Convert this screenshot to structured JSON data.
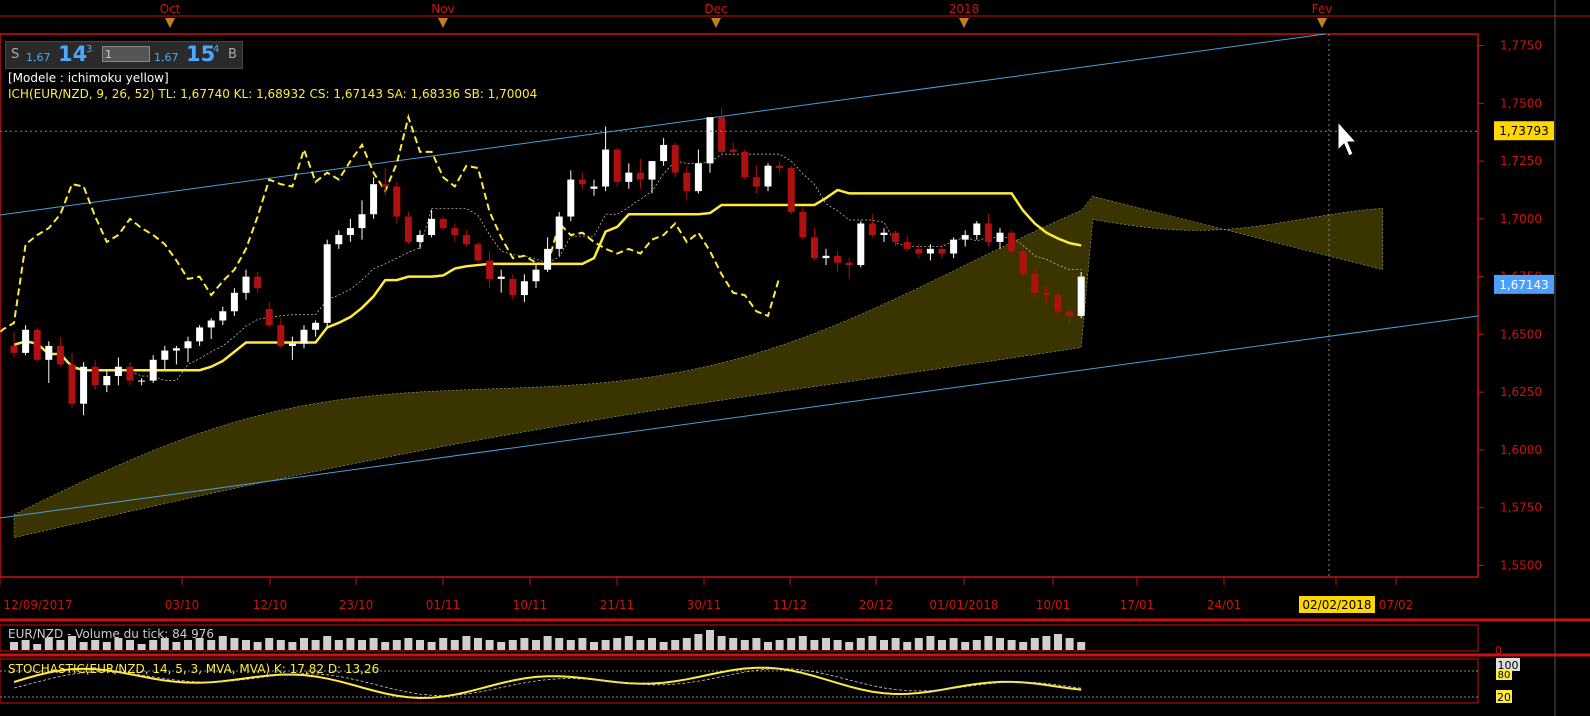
{
  "trade_panel": {
    "sell_label": "S",
    "bid_small": "1,67",
    "bid_big": "14",
    "bid_sup": "3",
    "quantity": "1",
    "ask_small": "1,67",
    "ask_big": "15",
    "ask_sup": "4",
    "buy_label": "B"
  },
  "info": {
    "model_line": "[Modele : ichimoku yellow]",
    "indicator_line": "ICH(EUR/NZD, 9, 26, 52)  TL: 1,67740  KL: 1,68932  CS: 1,67143  SA: 1,68336  SB: 1,70004"
  },
  "volume_panel": {
    "label": "EUR/NZD - Volume du tick: 84 976",
    "axis_zero": "0"
  },
  "stoch_panel": {
    "label": "STOCHASTIC(EUR/NZD, 14, 5, 3, MVA, MVA)  K: 17,82  D: 13,26",
    "level_100": "100",
    "level_80": "80",
    "level_20": "20"
  },
  "colors": {
    "axis": "#cc1111",
    "cloud": "#3a3500",
    "yellow": "#ffeb3b",
    "channel": "#4a9fd8",
    "up": "#ffffff",
    "down": "#b01010",
    "price_tag": "#4a9fff",
    "crosshair_tag": "#ffd700"
  },
  "chart_data": {
    "type": "candlestick",
    "symbol": "EUR/NZD",
    "top_axis_months": [
      "Oct",
      "Nov",
      "Dec",
      "2018",
      "Fev"
    ],
    "x_tick_labels": [
      "12/09/2017",
      "03/10",
      "12/10",
      "23/10",
      "01/11",
      "10/11",
      "21/11",
      "30/11",
      "11/12",
      "20/12",
      "01/01/2018",
      "10/01",
      "17/01",
      "24/01",
      "02/02/2018",
      "07/02"
    ],
    "y_tick_labels": [
      "1,7750",
      "1,7500",
      "1,7250",
      "1,7000",
      "1,6750",
      "1,6500",
      "1,6250",
      "1,6000",
      "1,5750",
      "1,5500"
    ],
    "ylim": [
      1.545,
      1.78
    ],
    "current_price_tag": "1,67143",
    "crosshair_price_tag": "1,73793",
    "crosshair_date_tag": "02/02/2018",
    "candles": [
      [
        1.645,
        1.651,
        1.64,
        1.642
      ],
      [
        1.642,
        1.654,
        1.641,
        1.652
      ],
      [
        1.652,
        1.653,
        1.638,
        1.639
      ],
      [
        1.639,
        1.647,
        1.629,
        1.645
      ],
      [
        1.645,
        1.649,
        1.636,
        1.637
      ],
      [
        1.637,
        1.642,
        1.618,
        1.62
      ],
      [
        1.62,
        1.638,
        1.615,
        1.636
      ],
      [
        1.636,
        1.639,
        1.626,
        1.628
      ],
      [
        1.628,
        1.634,
        1.625,
        1.632
      ],
      [
        1.632,
        1.64,
        1.628,
        1.636
      ],
      [
        1.636,
        1.638,
        1.628,
        1.63
      ],
      [
        1.63,
        1.631,
        1.628,
        1.63
      ],
      [
        1.63,
        1.641,
        1.629,
        1.639
      ],
      [
        1.639,
        1.645,
        1.635,
        1.643
      ],
      [
        1.643,
        1.645,
        1.637,
        1.644
      ],
      [
        1.644,
        1.649,
        1.638,
        1.647
      ],
      [
        1.647,
        1.654,
        1.645,
        1.653
      ],
      [
        1.653,
        1.657,
        1.648,
        1.656
      ],
      [
        1.656,
        1.662,
        1.654,
        1.66
      ],
      [
        1.66,
        1.67,
        1.658,
        1.668
      ],
      [
        1.668,
        1.678,
        1.665,
        1.675
      ],
      [
        1.675,
        1.677,
        1.668,
        1.67
      ],
      [
        1.661,
        1.664,
        1.653,
        1.654
      ],
      [
        1.654,
        1.657,
        1.644,
        1.645
      ],
      [
        1.645,
        1.649,
        1.639,
        1.646
      ],
      [
        1.646,
        1.654,
        1.644,
        1.652
      ],
      [
        1.652,
        1.656,
        1.649,
        1.655
      ],
      [
        1.655,
        1.691,
        1.653,
        1.689
      ],
      [
        1.689,
        1.695,
        1.687,
        1.693
      ],
      [
        1.693,
        1.7,
        1.69,
        1.696
      ],
      [
        1.696,
        1.708,
        1.691,
        1.702
      ],
      [
        1.702,
        1.718,
        1.7,
        1.715
      ],
      [
        1.715,
        1.722,
        1.71,
        1.714
      ],
      [
        1.714,
        1.716,
        1.698,
        1.701
      ],
      [
        1.701,
        1.703,
        1.689,
        1.69
      ],
      [
        1.69,
        1.695,
        1.687,
        1.693
      ],
      [
        1.693,
        1.704,
        1.692,
        1.7
      ],
      [
        1.7,
        1.701,
        1.695,
        1.696
      ],
      [
        1.696,
        1.698,
        1.69,
        1.693
      ],
      [
        1.693,
        1.695,
        1.688,
        1.689
      ],
      [
        1.689,
        1.69,
        1.681,
        1.682
      ],
      [
        1.682,
        1.686,
        1.67,
        1.674
      ],
      [
        1.674,
        1.678,
        1.668,
        1.675
      ],
      [
        1.674,
        1.676,
        1.665,
        1.667
      ],
      [
        1.667,
        1.676,
        1.664,
        1.673
      ],
      [
        1.673,
        1.68,
        1.67,
        1.678
      ],
      [
        1.678,
        1.692,
        1.677,
        1.687
      ],
      [
        1.687,
        1.703,
        1.684,
        1.701
      ],
      [
        1.701,
        1.721,
        1.699,
        1.717
      ],
      [
        1.717,
        1.72,
        1.713,
        1.715
      ],
      [
        1.713,
        1.717,
        1.71,
        1.714
      ],
      [
        1.714,
        1.74,
        1.712,
        1.73
      ],
      [
        1.73,
        1.731,
        1.714,
        1.716
      ],
      [
        1.716,
        1.724,
        1.713,
        1.72
      ],
      [
        1.72,
        1.726,
        1.713,
        1.717
      ],
      [
        1.717,
        1.724,
        1.711,
        1.725
      ],
      [
        1.725,
        1.735,
        1.723,
        1.732
      ],
      [
        1.732,
        1.733,
        1.718,
        1.72
      ],
      [
        1.72,
        1.723,
        1.708,
        1.712
      ],
      [
        1.712,
        1.73,
        1.711,
        1.724
      ],
      [
        1.724,
        1.741,
        1.72,
        1.744
      ],
      [
        1.744,
        1.748,
        1.727,
        1.729
      ],
      [
        1.73,
        1.733,
        1.727,
        1.729
      ],
      [
        1.729,
        1.73,
        1.717,
        1.718
      ],
      [
        1.718,
        1.723,
        1.711,
        1.714
      ],
      [
        1.714,
        1.724,
        1.712,
        1.723
      ],
      [
        1.723,
        1.725,
        1.72,
        1.722
      ],
      [
        1.722,
        1.723,
        1.702,
        1.703
      ],
      [
        1.703,
        1.705,
        1.691,
        1.692
      ],
      [
        1.692,
        1.696,
        1.682,
        1.683
      ],
      [
        1.683,
        1.687,
        1.68,
        1.684
      ],
      [
        1.684,
        1.686,
        1.677,
        1.681
      ],
      [
        1.681,
        1.683,
        1.674,
        1.68
      ],
      [
        1.68,
        1.699,
        1.679,
        1.698
      ],
      [
        1.698,
        1.702,
        1.692,
        1.693
      ],
      [
        1.693,
        1.696,
        1.69,
        1.694
      ],
      [
        1.694,
        1.695,
        1.688,
        1.69
      ],
      [
        1.69,
        1.693,
        1.686,
        1.687
      ],
      [
        1.687,
        1.689,
        1.683,
        1.685
      ],
      [
        1.685,
        1.689,
        1.682,
        1.687
      ],
      [
        1.687,
        1.689,
        1.683,
        1.685
      ],
      [
        1.685,
        1.692,
        1.683,
        1.691
      ],
      [
        1.691,
        1.695,
        1.688,
        1.693
      ],
      [
        1.693,
        1.699,
        1.691,
        1.698
      ],
      [
        1.698,
        1.702,
        1.688,
        1.69
      ],
      [
        1.69,
        1.696,
        1.687,
        1.694
      ],
      [
        1.694,
        1.695,
        1.685,
        1.686
      ],
      [
        1.686,
        1.688,
        1.675,
        1.676
      ],
      [
        1.676,
        1.678,
        1.666,
        1.668
      ],
      [
        1.668,
        1.671,
        1.663,
        1.667
      ],
      [
        1.667,
        1.669,
        1.658,
        1.66
      ],
      [
        1.66,
        1.662,
        1.654,
        1.658
      ],
      [
        1.658,
        1.677,
        1.657,
        1.675
      ]
    ],
    "volume": [
      4,
      5,
      3,
      6,
      5,
      7,
      4,
      5,
      4,
      6,
      5,
      3,
      5,
      6,
      4,
      5,
      6,
      5,
      7,
      6,
      5,
      4,
      6,
      5,
      4,
      6,
      5,
      7,
      5,
      6,
      5,
      6,
      4,
      5,
      6,
      5,
      4,
      6,
      5,
      7,
      6,
      5,
      4,
      5,
      6,
      5,
      7,
      6,
      5,
      6,
      4,
      5,
      6,
      7,
      5,
      6,
      4,
      5,
      6,
      8,
      10,
      7,
      6,
      5,
      6,
      4,
      5,
      6,
      7,
      5,
      6,
      5,
      4,
      6,
      7,
      5,
      6,
      4,
      6,
      7,
      5,
      6,
      4,
      5,
      7,
      6,
      5,
      4,
      6,
      7,
      8,
      6,
      4
    ]
  }
}
